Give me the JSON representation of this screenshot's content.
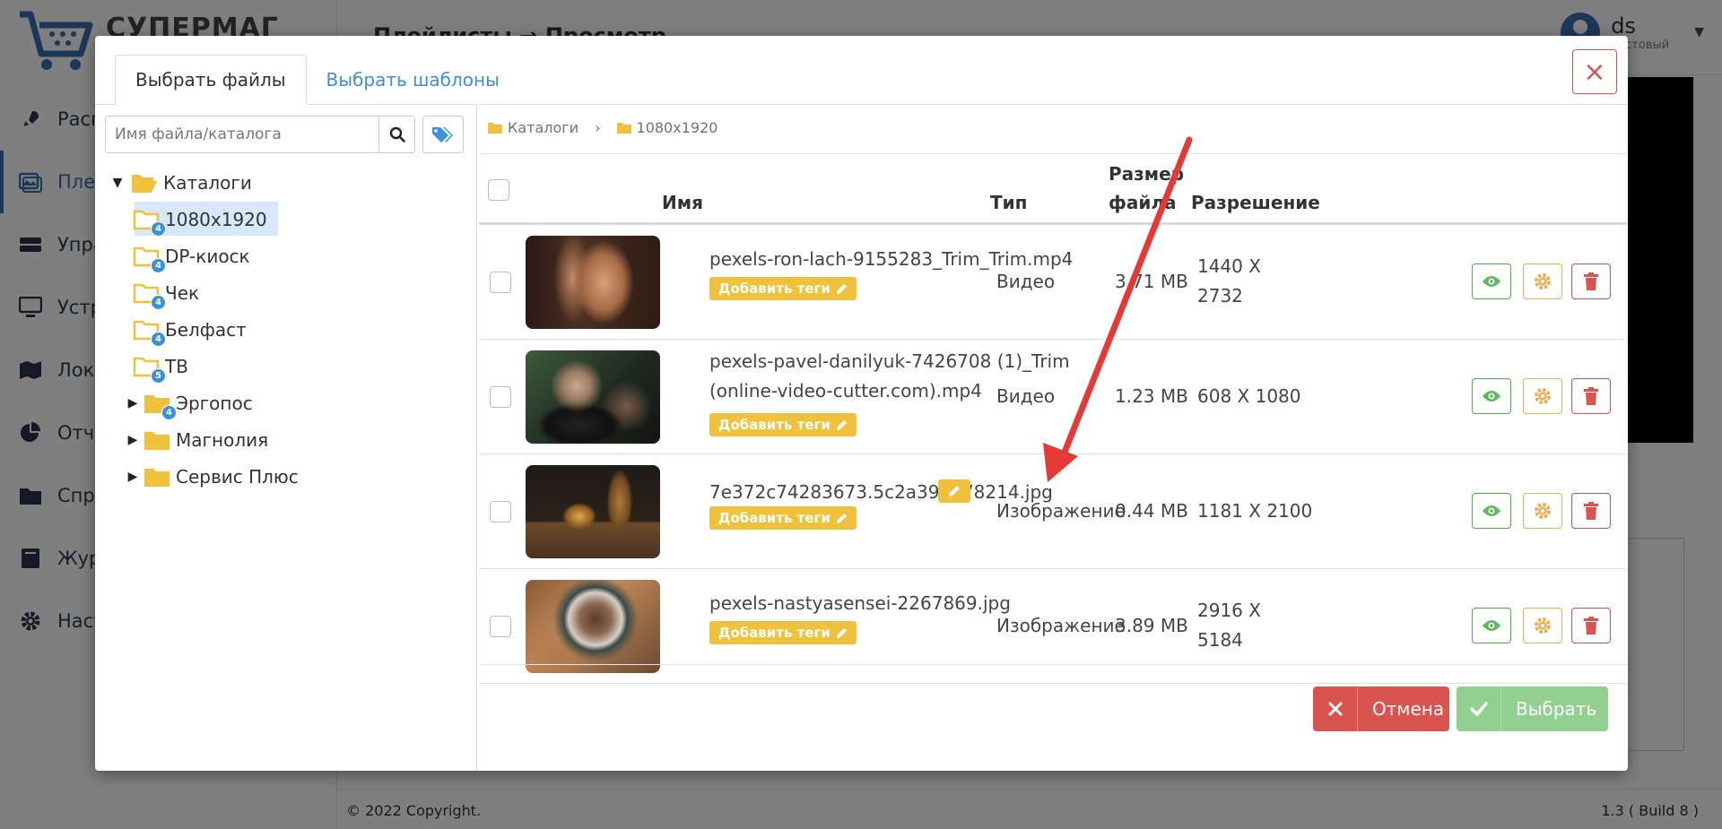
{
  "app": {
    "logo_text": "СУПЕРМАГ",
    "header_title": "Плейлисты → Просмотр",
    "user": {
      "name": "ds",
      "role": "Тестовый"
    },
    "nav": [
      {
        "label": "Расп",
        "icon": "rocket-icon"
      },
      {
        "label": "Плей",
        "icon": "images-icon",
        "active": true
      },
      {
        "label": "Упра",
        "icon": "server-icon"
      },
      {
        "label": "Устр",
        "icon": "monitor-icon"
      },
      {
        "label": "Лока",
        "icon": "map-icon"
      },
      {
        "label": "Отчё",
        "icon": "pie-chart-icon"
      },
      {
        "label": "Спра",
        "icon": "folder-icon"
      },
      {
        "label": "Жур",
        "icon": "book-icon"
      },
      {
        "label": "Наст",
        "icon": "gear-icon"
      }
    ],
    "footer": {
      "copyright": "© 2022 Copyright.",
      "version": "1.3 ( Build 8 )"
    }
  },
  "modal": {
    "tabs": {
      "files": "Выбрать файлы",
      "templates": "Выбрать шаблоны"
    },
    "close_label": "×",
    "search": {
      "placeholder": "Имя файла/каталога"
    },
    "tree": {
      "root": "Каталоги",
      "children": [
        {
          "label": "1080x1920",
          "badge": "4",
          "selected": true
        },
        {
          "label": "DP-киоск",
          "badge": "4"
        },
        {
          "label": "Чек",
          "badge": "4"
        },
        {
          "label": "Белфаст",
          "badge": "4"
        },
        {
          "label": "ТВ",
          "badge": "5"
        },
        {
          "label": "Эргопос",
          "badge": "4",
          "collapsed": true
        },
        {
          "label": "Магнолия",
          "collapsed": true
        },
        {
          "label": "Сервис Плюс",
          "collapsed": true
        }
      ]
    },
    "breadcrumb": {
      "root": "Каталоги",
      "current": "1080x1920"
    },
    "columns": {
      "name": "Имя",
      "type": "Тип",
      "size_line1": "Размер",
      "size_line2": "файла",
      "resolution": "Разрешение"
    },
    "tag_button_label": "Добавить теги",
    "rows": [
      {
        "name": "pexels-ron-lach-9155283_Trim_Trim.mp4",
        "type": "Видео",
        "size": "3.71 MB",
        "res_line1": "1440 X",
        "res_line2": "2732"
      },
      {
        "name_line1": "pexels-pavel-danilyuk-7426708 (1)_Trim",
        "name_line2": "(online-video-cutter.com).mp4",
        "type": "Видео",
        "size": "1.23 MB",
        "res_line1": "608 X 1080"
      },
      {
        "name": "7e372c74283673.5c2a397378214.jpg",
        "type": "Изображение",
        "size": "0.44 MB",
        "res_line1": "1181 X 2100"
      },
      {
        "name": "pexels-nastyasensei-2267869.jpg",
        "type": "Изображение",
        "size": "3.89 MB",
        "res_line1": "2916 X",
        "res_line2": "5184"
      }
    ],
    "buttons": {
      "cancel": "Отмена",
      "select": "Выбрать"
    }
  },
  "colors": {
    "accent": "#3b8fdb",
    "warning": "#f0c23b",
    "danger": "#d9534f",
    "success": "#5cb85c",
    "arrow": "#e53935"
  }
}
